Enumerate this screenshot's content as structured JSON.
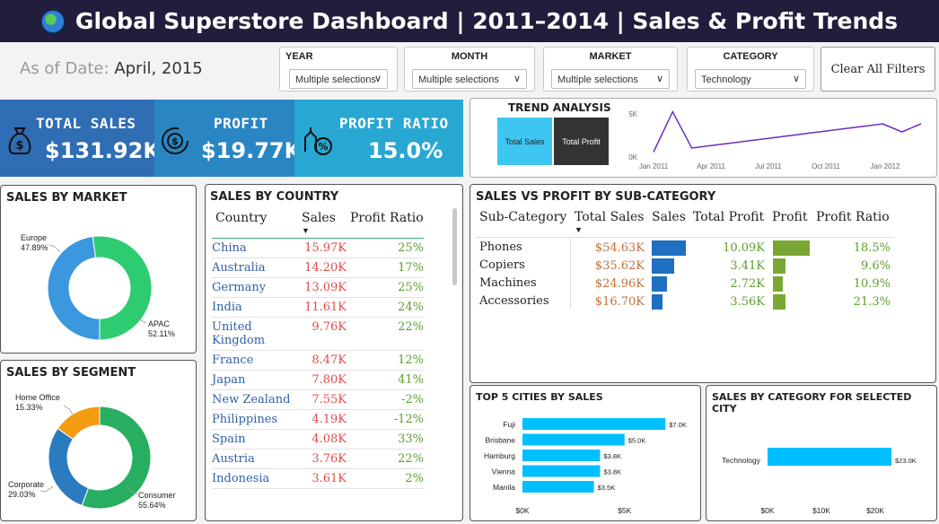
{
  "header": {
    "title": "Global Superstore Dashboard | 2011–2014 | Sales & Profit Trends",
    "icon": "globe-icon"
  },
  "as_of": {
    "label": "As of Date:",
    "value": "April, 2015"
  },
  "filters": [
    {
      "label": "YEAR",
      "value": "Multiple selections"
    },
    {
      "label": "MONTH",
      "value": "Multiple selections"
    },
    {
      "label": "MARKET",
      "value": "Multiple selections"
    },
    {
      "label": "CATEGORY",
      "value": "Technology"
    }
  ],
  "clear_filters": "Clear All Filters",
  "kpis": [
    {
      "title": "TOTAL SALES",
      "value": "$131.92K",
      "icon": "money-bag-icon",
      "color": "#2f6db4"
    },
    {
      "title": "PROFIT",
      "value": "$19.77K",
      "icon": "profit-cycle-icon",
      "color": "#2a86c2"
    },
    {
      "title": "PROFIT RATIO",
      "value": "15.0%",
      "icon": "growth-percent-icon",
      "color": "#28a7d3"
    }
  ],
  "trend": {
    "title": "TREND ANALYSIS",
    "buttons": [
      "Total Sales",
      "Total Profit"
    ],
    "yticks": [
      "5K",
      "0K"
    ],
    "xticks": [
      "Jan 2011",
      "Apr 2011",
      "Jul 2011",
      "Oct 2011",
      "Jan 2012"
    ],
    "values": [
      0.5,
      5.5,
      1.0,
      1.3,
      1.6,
      1.9,
      2.2,
      2.5,
      2.8,
      3.1,
      3.4,
      3.7,
      4.0,
      3.0,
      4.0
    ],
    "color": "#6b2fbf"
  },
  "market": {
    "title": "SALES BY MARKET",
    "slices": [
      {
        "name": "Europe",
        "pct": "47.89%",
        "value": 47.89,
        "color": "#3b97de"
      },
      {
        "name": "APAC",
        "pct": "52.11%",
        "value": 52.11,
        "color": "#2ecc71"
      }
    ]
  },
  "segment": {
    "title": "SALES BY SEGMENT",
    "slices": [
      {
        "name": "Consumer",
        "pct": "55.64%",
        "value": 55.64,
        "color": "#27ae60"
      },
      {
        "name": "Corporate",
        "pct": "29.03%",
        "value": 29.03,
        "color": "#2a7bbf"
      },
      {
        "name": "Home Office",
        "pct": "15.33%",
        "value": 15.33,
        "color": "#f39c12"
      }
    ]
  },
  "country": {
    "title": "SALES BY COUNTRY",
    "headers": [
      "Country",
      "Sales",
      "Profit Ratio"
    ],
    "rows": [
      {
        "country": "China",
        "sales": "15.97K",
        "ratio": "25%"
      },
      {
        "country": "Australia",
        "sales": "14.20K",
        "ratio": "17%"
      },
      {
        "country": "Germany",
        "sales": "13.09K",
        "ratio": "25%"
      },
      {
        "country": "India",
        "sales": "11.61K",
        "ratio": "24%"
      },
      {
        "country": "United Kingdom",
        "sales": "9.76K",
        "ratio": "22%"
      },
      {
        "country": "France",
        "sales": "8.47K",
        "ratio": "12%"
      },
      {
        "country": "Japan",
        "sales": "7.80K",
        "ratio": "41%"
      },
      {
        "country": "New Zealand",
        "sales": "7.55K",
        "ratio": "-2%"
      },
      {
        "country": "Philippines",
        "sales": "4.19K",
        "ratio": "-12%"
      },
      {
        "country": "Spain",
        "sales": "4.08K",
        "ratio": "33%"
      },
      {
        "country": "Austria",
        "sales": "3.76K",
        "ratio": "22%"
      },
      {
        "country": "Indonesia",
        "sales": "3.61K",
        "ratio": "2%"
      }
    ]
  },
  "subcat": {
    "title": "SALES VS PROFIT BY SUB-CATEGORY",
    "headers": [
      "Sub-Category",
      "Total Sales",
      "Sales",
      "Total Profit",
      "Profit",
      "Profit Ratio"
    ],
    "rows": [
      {
        "name": "Phones",
        "total_sales": "$54.63K",
        "sales": 54.63,
        "total_profit": "10.09K",
        "profit": 10.09,
        "ratio": "18.5%"
      },
      {
        "name": "Copiers",
        "total_sales": "$35.62K",
        "sales": 35.62,
        "total_profit": "3.41K",
        "profit": 3.41,
        "ratio": "9.6%"
      },
      {
        "name": "Machines",
        "total_sales": "$24.96K",
        "sales": 24.96,
        "total_profit": "2.72K",
        "profit": 2.72,
        "ratio": "10.9%"
      },
      {
        "name": "Accessories",
        "total_sales": "$16.70K",
        "sales": 16.7,
        "total_profit": "3.56K",
        "profit": 3.56,
        "ratio": "21.3%"
      }
    ],
    "colors": {
      "sales": "#1f6fc3",
      "profit": "#7aa733"
    }
  },
  "chart_data": [
    {
      "type": "bar",
      "title": "TOP 5 CITIES BY SALES",
      "categories": [
        "Fuji",
        "Brisbane",
        "Hamburg",
        "Vienna",
        "Manila"
      ],
      "values": [
        7.0,
        5.0,
        3.8,
        3.8,
        3.5
      ],
      "labels": [
        "$7.0K",
        "$5.0K",
        "$3.8K",
        "$3.8K",
        "$3.5K"
      ],
      "xticks": [
        "$0K",
        "$5K"
      ],
      "xlim": [
        0,
        8
      ],
      "orientation": "horizontal",
      "color": "#00bfff"
    },
    {
      "type": "bar",
      "title": "SALES BY CATEGORY FOR SELECTED CITY",
      "categories": [
        "Technology"
      ],
      "values": [
        23.0
      ],
      "labels": [
        "$23.0K"
      ],
      "xticks": [
        "$0K",
        "$10K",
        "$20K"
      ],
      "xlim": [
        0,
        26
      ],
      "orientation": "horizontal",
      "color": "#00bfff"
    }
  ]
}
